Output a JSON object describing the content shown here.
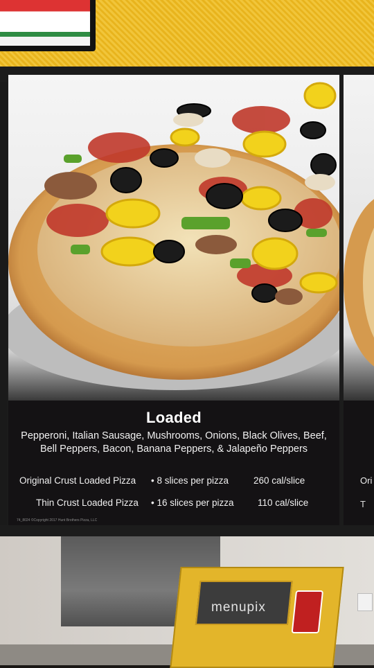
{
  "menu": {
    "title": "Loaded",
    "toppings_line1": "Pepperoni, Italian Sausage, Mushrooms, Onions, Black Olives, Beef,",
    "toppings_line2": "Bell Peppers, Bacon, Banana Peppers, & Jalapeño Peppers",
    "rows": [
      {
        "name": "Original Crust Loaded Pizza",
        "slices": "• 8 slices per pizza",
        "calories": "260 cal/slice"
      },
      {
        "name": "Thin Crust Loaded Pizza",
        "slices": "• 16 slices per pizza",
        "calories": "110 cal/slice"
      }
    ],
    "fine_print": "74_8024   ©Copyright 2017 Hunt Brothers Pizza, LLC"
  },
  "right_panel": {
    "text1": "Ori",
    "text2": "T"
  },
  "watermark": "menupix",
  "colors": {
    "panel_bg": "#141214",
    "wall_yellow": "#f1c53a",
    "box_yellow": "#e3b52a"
  }
}
